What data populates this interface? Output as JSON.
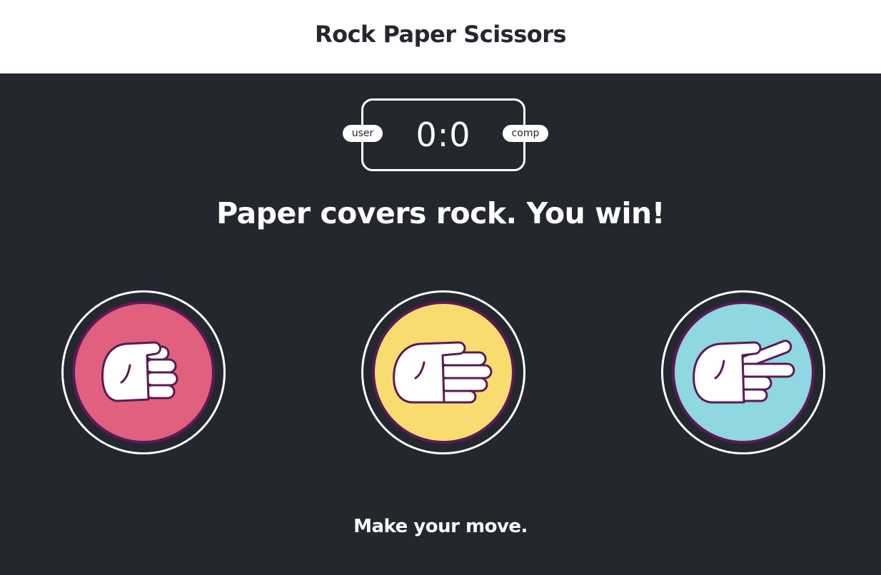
{
  "header": {
    "title": "Rock Paper Scissors"
  },
  "scoreboard": {
    "score": "0:0",
    "user_label": "user",
    "comp_label": "comp"
  },
  "result_text": "Paper covers rock. You win!",
  "choices": [
    {
      "id": "rock",
      "icon": "rock-hand-icon",
      "color": "#e0607e"
    },
    {
      "id": "paper",
      "icon": "paper-hand-icon",
      "color": "#f9dc6f"
    },
    {
      "id": "scissors",
      "icon": "scissors-hand-icon",
      "color": "#8fd7e1"
    }
  ],
  "message": "Make your move.",
  "colors": {
    "background": "#24272e",
    "header_background": "#ffffff",
    "outline": "#5b1a56",
    "text_light": "#ffffff"
  }
}
